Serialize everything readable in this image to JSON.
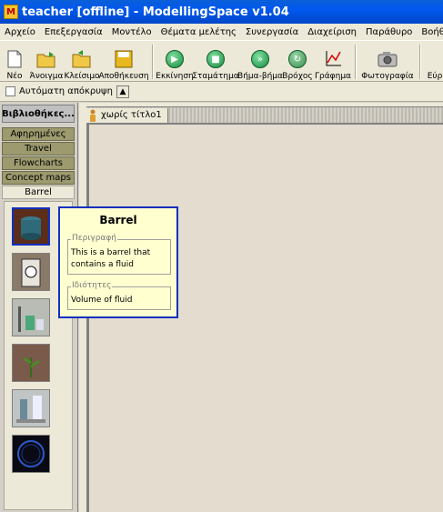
{
  "window": {
    "title": "teacher [offline] - ModellingSpace v1.04"
  },
  "menu": [
    "Αρχείο",
    "Επεξεργασία",
    "Μοντέλο",
    "Θέματα μελέτης",
    "Συνεργασία",
    "Διαχείριση",
    "Παράθυρο",
    "Βοήθεια"
  ],
  "toolbar": {
    "new": "Νέο",
    "open": "Άνοιγμα",
    "close": "Κλείσιμο",
    "save": "Αποθήκευση",
    "run": "Εκκίνηση",
    "stop": "Σταμάτημα",
    "step": "Βήμα-βήμα",
    "loop": "Βρόχος",
    "graph": "Γράφημα",
    "photo": "Φωτογραφία",
    "more": "Εύρ"
  },
  "toolbar2": {
    "autohide": "Αυτόματη απόκρυψη"
  },
  "library": {
    "header": "Βιβλιοθήκες...",
    "tabs": [
      "Αφηρημένες",
      "Travel",
      "Flowcharts",
      "Concept maps",
      "Barrel"
    ],
    "active_tab": "Barrel"
  },
  "document": {
    "tab": "χωρίς τίτλο1"
  },
  "tooltip": {
    "title": "Barrel",
    "description_label": "Περιγραφή",
    "description": "This is a barrel that contains a fluid",
    "properties_label": "Ιδιότητες",
    "properties": "Volume of fluid"
  },
  "colors": {
    "titlebar": "#0058ee",
    "tab_bg": "#9c9a6e",
    "tooltip_bg": "#ffffd0",
    "tooltip_border": "#1030c0"
  }
}
